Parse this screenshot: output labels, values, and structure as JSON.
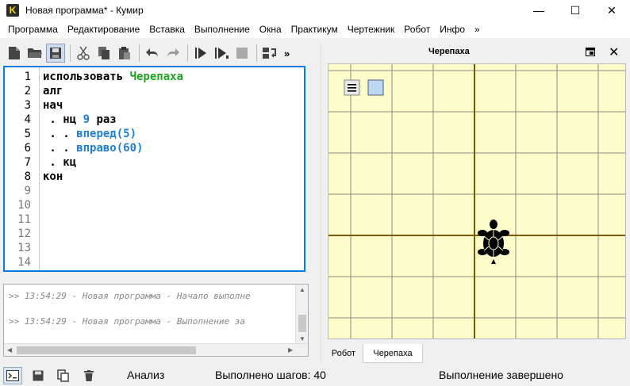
{
  "window": {
    "title": "Новая программа* - Кумир",
    "app_icon_letter": "K",
    "minimize_glyph": "—",
    "maximize_glyph": "☐",
    "close_glyph": "✕"
  },
  "menu": [
    "Программа",
    "Редактирование",
    "Вставка",
    "Выполнение",
    "Окна",
    "Практикум",
    "Чертежник",
    "Робот",
    "Инфо",
    "»"
  ],
  "toolbar": {
    "more_glyph": "»",
    "icons": [
      "new-file-icon",
      "open-folder-icon",
      "save-icon",
      "cut-icon",
      "copy-icon",
      "paste-icon",
      "undo-icon",
      "redo-icon",
      "run-icon",
      "run-step-icon",
      "stop-icon",
      "step-into-icon"
    ]
  },
  "editor": {
    "line_numbers": [
      "1",
      "2",
      "3",
      "4",
      "5",
      "6",
      "7",
      "8",
      "9",
      "10",
      "11",
      "12",
      "13",
      "14"
    ],
    "lines": [
      [
        {
          "t": "использовать ",
          "c": "plain"
        },
        {
          "t": "Черепаха",
          "c": "green"
        }
      ],
      [
        {
          "t": "алг",
          "c": "plain"
        }
      ],
      [
        {
          "t": "нач",
          "c": "plain"
        }
      ],
      [
        {
          "t": " . нц ",
          "c": "plain"
        },
        {
          "t": "9",
          "c": "blue"
        },
        {
          "t": " раз",
          "c": "plain"
        }
      ],
      [
        {
          "t": " . . ",
          "c": "plain"
        },
        {
          "t": "вперед(5)",
          "c": "blue"
        }
      ],
      [
        {
          "t": " . . ",
          "c": "plain"
        },
        {
          "t": "вправо(60)",
          "c": "blue"
        }
      ],
      [
        {
          "t": " . кц",
          "c": "plain"
        }
      ],
      [
        {
          "t": "кон",
          "c": "plain"
        }
      ]
    ]
  },
  "console": {
    "lines": [
      ">> 13:54:29 - Новая программа - Начало выполне",
      ">> 13:54:29 - Новая программа - Выполнение за"
    ]
  },
  "turtle_panel": {
    "title": "Черепаха",
    "float_glyph": "▣",
    "close_glyph": "✕",
    "tabs": [
      "Робот",
      "Черепаха"
    ],
    "active_tab": "Черепаха"
  },
  "statusbar": {
    "mode": "Анализ",
    "steps": "Выполнено шагов: 40",
    "state": "Выполнение завершено"
  },
  "colors": {
    "accent": "#0a7bd6",
    "canvas_bg": "#fdfdcc",
    "grid": "#8a8a8a",
    "axis": "#7a5a00",
    "keyword_green": "#1fa31f",
    "number_blue": "#1f7fd0"
  }
}
